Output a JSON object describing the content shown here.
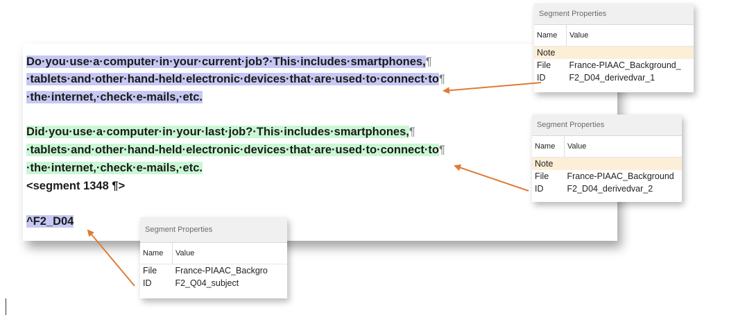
{
  "document": {
    "para1": {
      "line1": "Do·you·use·a·computer·in·your·current·job?·This·includes·smartphones,",
      "line2": "·tablets·and·other·hand-held·electronic·devices·that·are·used·to·connect·to",
      "line3": "·the·internet,·check·e-mails,·etc."
    },
    "para2": {
      "line1": "Did·you·use·a·computer·in·your·last·job?·This·includes·smartphones,",
      "line2": "·tablets·and·other·hand-held·electronic·devices·that·are·used·to·connect·to",
      "line3": "·the·internet,·check·e-mails,·etc."
    },
    "segment_tag": "<segment 1348 ¶>",
    "tag_code": "^F2_D04",
    "pilcrow": "¶"
  },
  "panels": [
    {
      "title": "Segment Properties",
      "header": {
        "name": "Name",
        "value": "Value"
      },
      "note_label": "Note",
      "file_label": "File",
      "file_value": "France-PIAAC_Background_",
      "id_label": "ID",
      "id_value": "F2_D04_derivedvar_1"
    },
    {
      "title": "Segment Properties",
      "header": {
        "name": "Name",
        "value": "Value"
      },
      "note_label": "Note",
      "file_label": "File",
      "file_value": "France-PIAAC_Background",
      "id_label": "ID",
      "id_value": "F2_D04_derivedvar_2"
    },
    {
      "title": "Segment Properties",
      "header": {
        "name": "Name",
        "value": "Value"
      },
      "file_label": "File",
      "file_value": "France-PIAAC_Backgro",
      "id_label": "ID",
      "id_value": "F2_Q04_subject"
    }
  ],
  "colors": {
    "highlight_blue": "#c6c8f3",
    "highlight_green": "#c9f7d3",
    "arrow": "#e07a36",
    "note_row": "#fdeed8"
  }
}
